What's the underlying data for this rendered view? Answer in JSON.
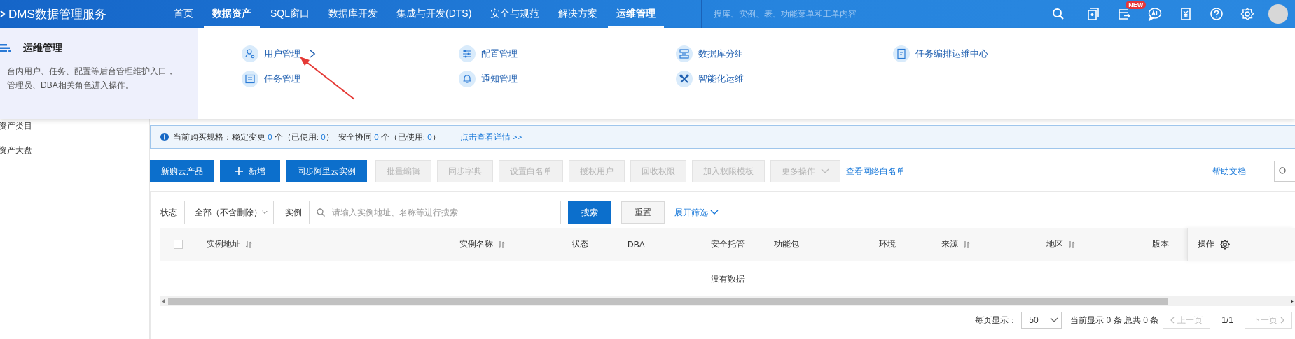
{
  "header": {
    "logo": "DMS数据管理服务",
    "nav": [
      {
        "label": "首页",
        "selected": false
      },
      {
        "label": "数据资产",
        "selected": true
      },
      {
        "label": "SQL窗口",
        "selected": false
      },
      {
        "label": "数据库开发",
        "selected": false
      },
      {
        "label": "集成与开发(DTS)",
        "selected": false
      },
      {
        "label": "安全与规范",
        "selected": false
      },
      {
        "label": "解决方案",
        "selected": false
      },
      {
        "label": "运维管理",
        "selected": true
      }
    ],
    "search": {
      "placeholder": "搜库、实例、表、功能菜单和工单内容"
    },
    "badge": "NEW"
  },
  "menu_panel": {
    "title": "运维管理",
    "description_lines": [
      "台内用户、任务、配置等后台管理维护入口，",
      "管理员、DBA相关角色进入操作。"
    ],
    "items": [
      {
        "label": "用户管理",
        "hovered": true
      },
      {
        "label": "配置管理",
        "hovered": false
      },
      {
        "label": "数据库分组",
        "hovered": false
      },
      {
        "label": "任务编排运维中心",
        "hovered": false
      },
      {
        "label": "任务管理",
        "hovered": false
      },
      {
        "label": "通知管理",
        "hovered": false
      },
      {
        "label": "智能化运维",
        "hovered": false
      }
    ]
  },
  "sidebar": {
    "items": [
      "资产类目",
      "资产大盘"
    ]
  },
  "notice": {
    "parts": [
      {
        "text": "当前购买规格：稳定变更 ",
        "kind": "plain"
      },
      {
        "text": "0",
        "kind": "number"
      },
      {
        "text": " 个（已使用: ",
        "kind": "plain"
      },
      {
        "text": "0",
        "kind": "number"
      },
      {
        "text": "）  安全协同 ",
        "kind": "plain"
      },
      {
        "text": "0",
        "kind": "number"
      },
      {
        "text": " 个（已使用: ",
        "kind": "plain"
      },
      {
        "text": "0",
        "kind": "number"
      },
      {
        "text": "）",
        "kind": "plain"
      }
    ],
    "link": "点击查看详情 >>"
  },
  "toolbar": {
    "buttons": [
      {
        "label": "新购云产品",
        "kind": "primary"
      },
      {
        "label": "新增",
        "kind": "add"
      },
      {
        "label": "同步阿里云实例",
        "kind": "primary"
      },
      {
        "label": "批量编辑",
        "kind": "disabled"
      },
      {
        "label": "同步字典",
        "kind": "disabled"
      },
      {
        "label": "设置白名单",
        "kind": "disabled"
      },
      {
        "label": "授权用户",
        "kind": "disabled"
      },
      {
        "label": "回收权限",
        "kind": "disabled"
      },
      {
        "label": "加入权限模板",
        "kind": "disabled"
      },
      {
        "label": "更多操作",
        "kind": "menu"
      },
      {
        "label": "查看网络白名单",
        "kind": "link"
      }
    ],
    "help_link": "帮助文档"
  },
  "filters": {
    "status_label": "状态",
    "status_value": "全部（不含删除）",
    "instance_label": "实例",
    "search_placeholder": "请输入实例地址、名称等进行搜索",
    "search_button": "搜索",
    "reset_button": "重置",
    "expand_link": "展开筛选"
  },
  "table": {
    "columns": [
      {
        "label": "实例地址",
        "sortable": true
      },
      {
        "label": "实例名称",
        "sortable": true
      },
      {
        "label": "状态",
        "sortable": false
      },
      {
        "label": "DBA",
        "sortable": false
      },
      {
        "label": "安全托管",
        "sortable": false
      },
      {
        "label": "功能包",
        "sortable": false
      },
      {
        "label": "环境",
        "sortable": false
      },
      {
        "label": "来源",
        "sortable": true
      },
      {
        "label": "地区",
        "sortable": true
      },
      {
        "label": "版本",
        "sortable": false
      }
    ],
    "select_all_checked": false,
    "action_column": "操作",
    "empty_text": "没有数据"
  },
  "pagination": {
    "page_size_label": "每页显示：",
    "page_size": "50",
    "summary": "当前显示 0 条 总共 0 条",
    "prev": "上一页",
    "page": "1/1",
    "next": "下一页"
  }
}
